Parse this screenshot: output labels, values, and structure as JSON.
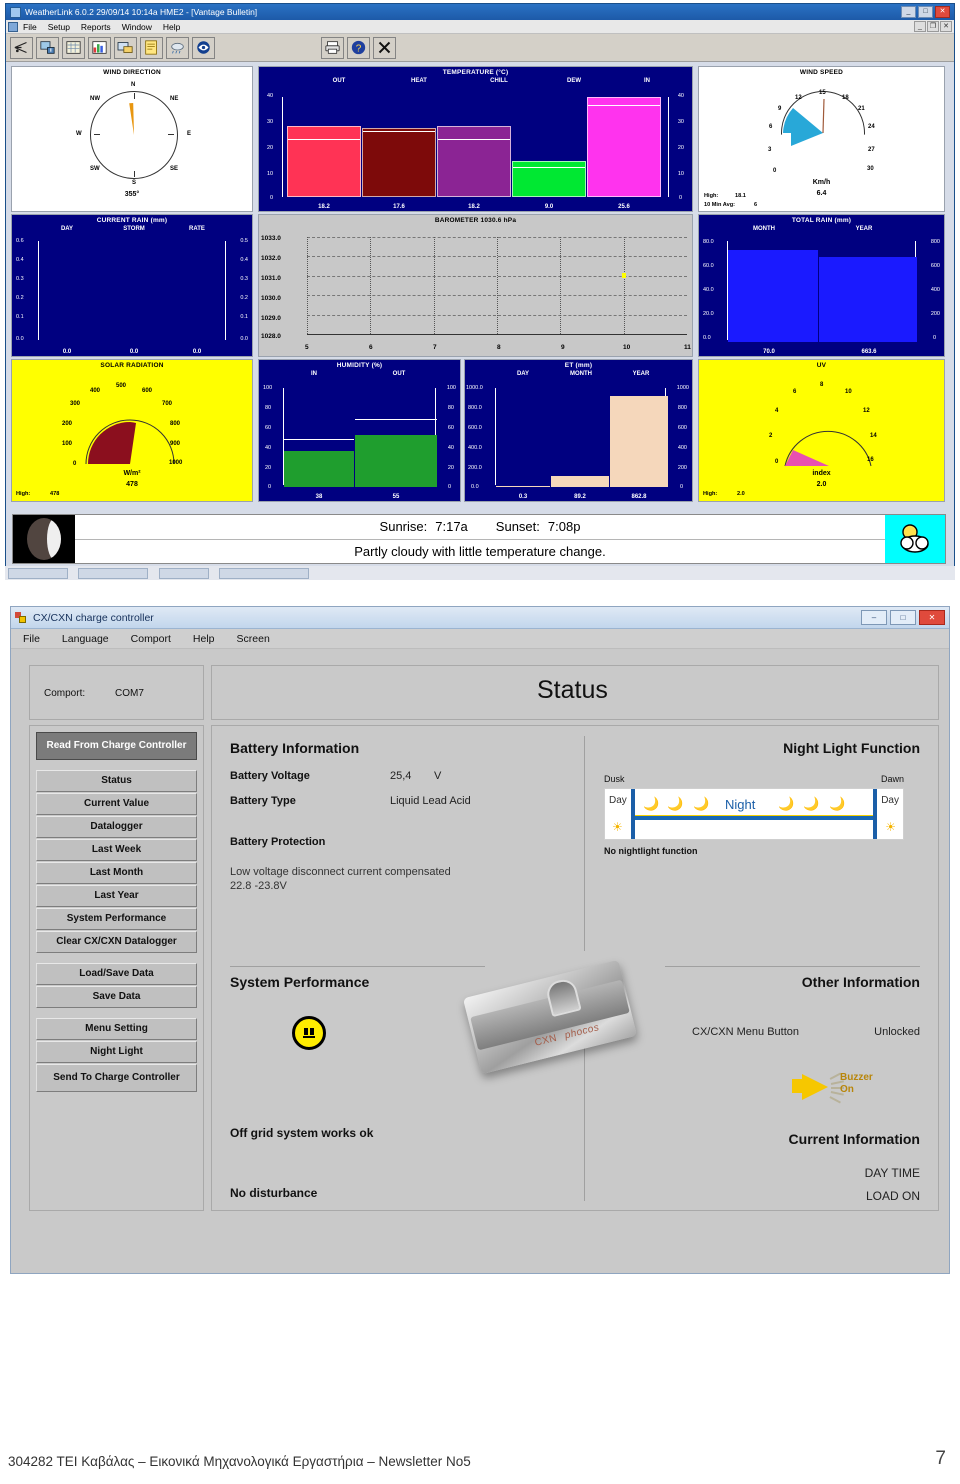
{
  "weatherlink": {
    "title": "WeatherLink 6.0.2  29/09/14  10:14a HME2 - [Vantage Bulletin]",
    "title_icon": "weatherlink-icon",
    "window_buttons": {
      "minimize": "_",
      "maximize": "□",
      "close": "✕"
    },
    "mdi_buttons": {
      "minimize": "_",
      "restore": "❐",
      "close": "✕"
    },
    "menus": [
      "File",
      "Setup",
      "Reports",
      "Window",
      "Help"
    ],
    "toolbar_icons": [
      "station-icon",
      "download-icon",
      "browse-data-icon",
      "plot-icon",
      "summary-icon",
      "notes-icon",
      "weather-icon",
      "noaa-icon",
      "print-icon",
      "help-icon",
      "close-icon"
    ],
    "panels": {
      "wind_direction": {
        "title": "WIND DIRECTION",
        "labels": [
          "N",
          "NE",
          "E",
          "SE",
          "S",
          "SW",
          "W",
          "NW"
        ],
        "value": "355°",
        "needle_deg": 355
      },
      "temperature": {
        "title": "TEMPERATURE  (°C)",
        "columns": [
          "OUT",
          "HEAT",
          "CHILL",
          "DEW",
          "IN"
        ],
        "values": [
          "18.2",
          "17.6",
          "18.2",
          "9.0",
          "25.6"
        ],
        "axis_ticks": [
          "40",
          "30",
          "20",
          "10",
          "0"
        ],
        "colors": [
          "#ff3355",
          "#7d0a0a",
          "#8b2494",
          "#00e832",
          "#ff33ee"
        ]
      },
      "wind_speed": {
        "title": "WIND SPEED",
        "ticks": [
          "0",
          "3",
          "6",
          "9",
          "12",
          "15",
          "18",
          "21",
          "24",
          "27",
          "30"
        ],
        "unit": "Km/h",
        "value": "6.4",
        "high_label": "High:",
        "high_value": "18.1",
        "avg_label": "10 Min Avg:",
        "avg_value": "6"
      },
      "current_rain": {
        "title": "CURRENT RAIN  (mm)",
        "columns": [
          "DAY",
          "STORM",
          "RATE"
        ],
        "values": [
          "0.0",
          "0.0",
          "0.0"
        ],
        "axis_left": [
          "0.6",
          "0.4",
          "0.3",
          "0.2",
          "0.1",
          "0.0"
        ],
        "axis_right": [
          "0.5",
          "0.4",
          "0.3",
          "0.2",
          "0.1",
          "0.0"
        ]
      },
      "barometer": {
        "title": "BAROMETER 1030.6 hPa",
        "y_ticks": [
          "1033.0",
          "1032.0",
          "1031.0",
          "1030.0",
          "1029.0",
          "1028.0"
        ],
        "x_ticks": [
          "5",
          "6",
          "7",
          "8",
          "9",
          "10",
          "11"
        ],
        "point": {
          "x": "10",
          "y": "1030.7"
        }
      },
      "total_rain": {
        "title": "TOTAL RAIN  (mm)",
        "columns": [
          "MONTH",
          "YEAR"
        ],
        "values": [
          "70.0",
          "663.6"
        ],
        "axis_left": [
          "80.0",
          "60.0",
          "40.0",
          "20.0",
          "0.0"
        ],
        "axis_right": [
          "800",
          "600",
          "400",
          "200",
          "0"
        ]
      },
      "solar_radiation": {
        "title": "SOLAR RADIATION",
        "ticks": [
          "0",
          "100",
          "200",
          "300",
          "400",
          "500",
          "600",
          "700",
          "800",
          "900",
          "1000"
        ],
        "unit": "W/m²",
        "value": "478",
        "high_label": "High:",
        "high_value": "478"
      },
      "humidity": {
        "title": "HUMIDITY  (%)",
        "columns": [
          "IN",
          "OUT"
        ],
        "values": [
          "38",
          "55"
        ],
        "axis": [
          "100",
          "80",
          "60",
          "40",
          "20",
          "0"
        ]
      },
      "et": {
        "title": "ET  (mm)",
        "columns": [
          "DAY",
          "MONTH",
          "YEAR"
        ],
        "values": [
          "0.3",
          "89.2",
          "862.8"
        ],
        "axis_left": [
          "1000.0",
          "800.0",
          "600.0",
          "400.0",
          "200.0",
          "0.0"
        ],
        "axis_right": [
          "1000",
          "800",
          "600",
          "400",
          "200",
          "0"
        ]
      },
      "uv": {
        "title": "UV",
        "ticks": [
          "0",
          "2",
          "4",
          "6",
          "8",
          "10",
          "12",
          "14",
          "16"
        ],
        "unit": "index",
        "value": "2.0",
        "high_label": "High:",
        "high_value": "2.0"
      }
    },
    "sun": {
      "sunrise_label": "Sunrise:",
      "sunrise_value": "7:17a",
      "sunset_label": "Sunset:",
      "sunset_value": "7:08p",
      "forecast": "Partly cloudy with little temperature change.",
      "moon_icon": "moon-phase-icon",
      "weather_icon": "partly-cloudy-icon"
    }
  },
  "charge_controller": {
    "title": "CX/CXN charge controller",
    "window_buttons": {
      "minimize": "–",
      "maximize": "□",
      "close": "✕"
    },
    "menus": [
      "File",
      "Language",
      "Comport",
      "Help",
      "Screen"
    ],
    "comport": {
      "label": "Comport:",
      "value": "COM7"
    },
    "page_title": "Status",
    "sidebar": {
      "read_button": "Read From Charge Controller",
      "buttons": [
        "Status",
        "Current Value",
        "Datalogger",
        "Last Week",
        "Last Month",
        "Last Year",
        "System Performance",
        "Clear CX/CXN Datalogger"
      ],
      "buttons2": [
        "Load/Save Data",
        "Save Data"
      ],
      "buttons3": [
        "Menu Setting",
        "Night Light",
        "Send To Charge Controller"
      ]
    },
    "battery": {
      "section_title": "Battery Information",
      "voltage_label": "Battery Voltage",
      "voltage_value": "25,4",
      "voltage_unit": "V",
      "type_label": "Battery Type",
      "type_value": "Liquid Lead Acid",
      "protection_title": "Battery Protection",
      "protection_text": "Low voltage disconnect current compensated 22.8 -23.8V"
    },
    "night_light": {
      "section_title": "Night Light Function",
      "dusk": "Dusk",
      "dawn": "Dawn",
      "day_left": "Day",
      "day_right": "Day",
      "night": "Night",
      "note": "No nightlight function"
    },
    "system_performance": {
      "section_title": "System Performance",
      "face_icon": "neutral-face-icon",
      "line1": "Off grid system works ok",
      "line2": "No disturbance"
    },
    "other_information": {
      "section_title": "Other Information",
      "menu_button_label": "CX/CXN Menu Button",
      "menu_button_value": "Unlocked",
      "buzzer_icon": "speaker-icon",
      "buzzer_line1": "Buzzer",
      "buzzer_line2": "On"
    },
    "current_information": {
      "section_title": "Current Information",
      "line1": "DAY TIME",
      "line2": "LOAD ON"
    },
    "product_photo": {
      "brand1": "CXN",
      "brand2": "phocos"
    }
  },
  "footer": {
    "text": "304282 ΤΕΙ Καβάλας – Εικονικά Μηχανολογικά Εργαστήρια – Newsletter No5",
    "page": "7"
  },
  "chart_data": [
    {
      "type": "bar",
      "title": "TEMPERATURE  (°C)",
      "categories": [
        "OUT",
        "HEAT",
        "CHILL",
        "DEW",
        "IN"
      ],
      "values": [
        18.2,
        17.6,
        18.2,
        9.0,
        25.6
      ],
      "ylim": [
        0,
        40
      ],
      "ylabel": "°C",
      "grid": false
    },
    {
      "type": "bar",
      "title": "CURRENT RAIN  (mm)",
      "categories": [
        "DAY",
        "STORM",
        "RATE"
      ],
      "values": [
        0.0,
        0.0,
        0.0
      ],
      "ylim": [
        0,
        0.6
      ],
      "ylabel": "mm",
      "grid": false
    },
    {
      "type": "line",
      "title": "BAROMETER 1030.6 hPa",
      "x": [
        5,
        6,
        7,
        8,
        9,
        10,
        11
      ],
      "values": [
        null,
        null,
        null,
        null,
        null,
        1030.7,
        null
      ],
      "ylim": [
        1028.0,
        1033.0
      ],
      "ylabel": "hPa",
      "grid": true
    },
    {
      "type": "bar",
      "title": "TOTAL RAIN  (mm)",
      "categories": [
        "MONTH",
        "YEAR"
      ],
      "values": [
        70.0,
        663.6
      ],
      "ylim": [
        0,
        80
      ],
      "ylabel": "mm",
      "grid": false
    },
    {
      "type": "bar",
      "title": "HUMIDITY  (%)",
      "categories": [
        "IN",
        "OUT"
      ],
      "values": [
        38,
        55
      ],
      "ylim": [
        0,
        100
      ],
      "ylabel": "%",
      "grid": false
    },
    {
      "type": "bar",
      "title": "ET  (mm)",
      "categories": [
        "DAY",
        "MONTH",
        "YEAR"
      ],
      "values": [
        0.3,
        89.2,
        862.8
      ],
      "ylim": [
        0,
        1000
      ],
      "ylabel": "mm",
      "grid": false
    },
    {
      "type": "gauge",
      "title": "WIND SPEED",
      "value": 6.4,
      "ylim": [
        0,
        30
      ],
      "ylabel": "Km/h"
    },
    {
      "type": "gauge",
      "title": "SOLAR RADIATION",
      "value": 478,
      "ylim": [
        0,
        1000
      ],
      "ylabel": "W/m²"
    },
    {
      "type": "gauge",
      "title": "UV",
      "value": 2.0,
      "ylim": [
        0,
        16
      ],
      "ylabel": "index"
    },
    {
      "type": "gauge",
      "title": "WIND DIRECTION",
      "value": 355,
      "ylim": [
        0,
        360
      ],
      "ylabel": "degrees"
    }
  ]
}
